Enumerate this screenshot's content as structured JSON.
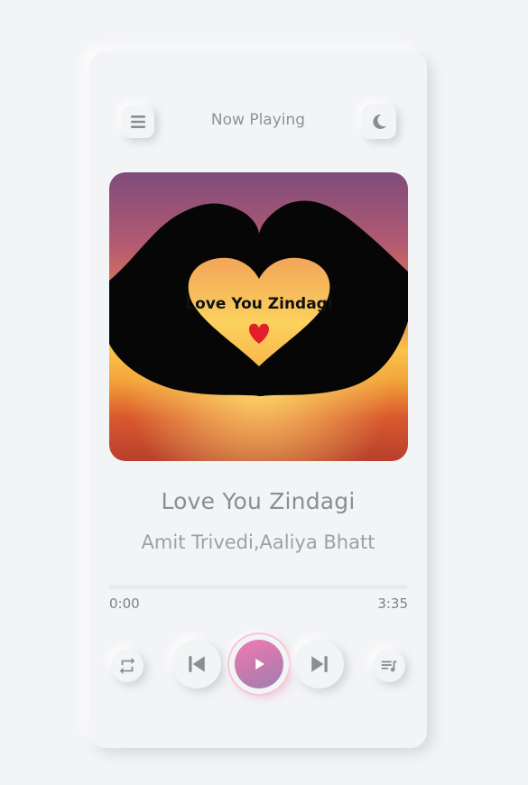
{
  "header": {
    "title": "Now Playing",
    "menu_icon": "menu-icon",
    "theme_icon": "moon-icon"
  },
  "album": {
    "caption": "Love You Zindagi",
    "emoji": "❤️"
  },
  "track": {
    "title": "Love You Zindagi",
    "artist": "Amit Trivedi,Aaliya Bhatt"
  },
  "progress": {
    "current": "0:00",
    "duration": "3:35",
    "fraction": 0
  },
  "controls": {
    "repeat_icon": "repeat-icon",
    "prev_icon": "skip-previous-icon",
    "play_icon": "play-icon",
    "next_icon": "skip-next-icon",
    "playlist_icon": "playlist-icon"
  },
  "colors": {
    "accent_start": "#f07bb5",
    "accent_end": "#a17fb2",
    "text": "#8b8e93"
  }
}
